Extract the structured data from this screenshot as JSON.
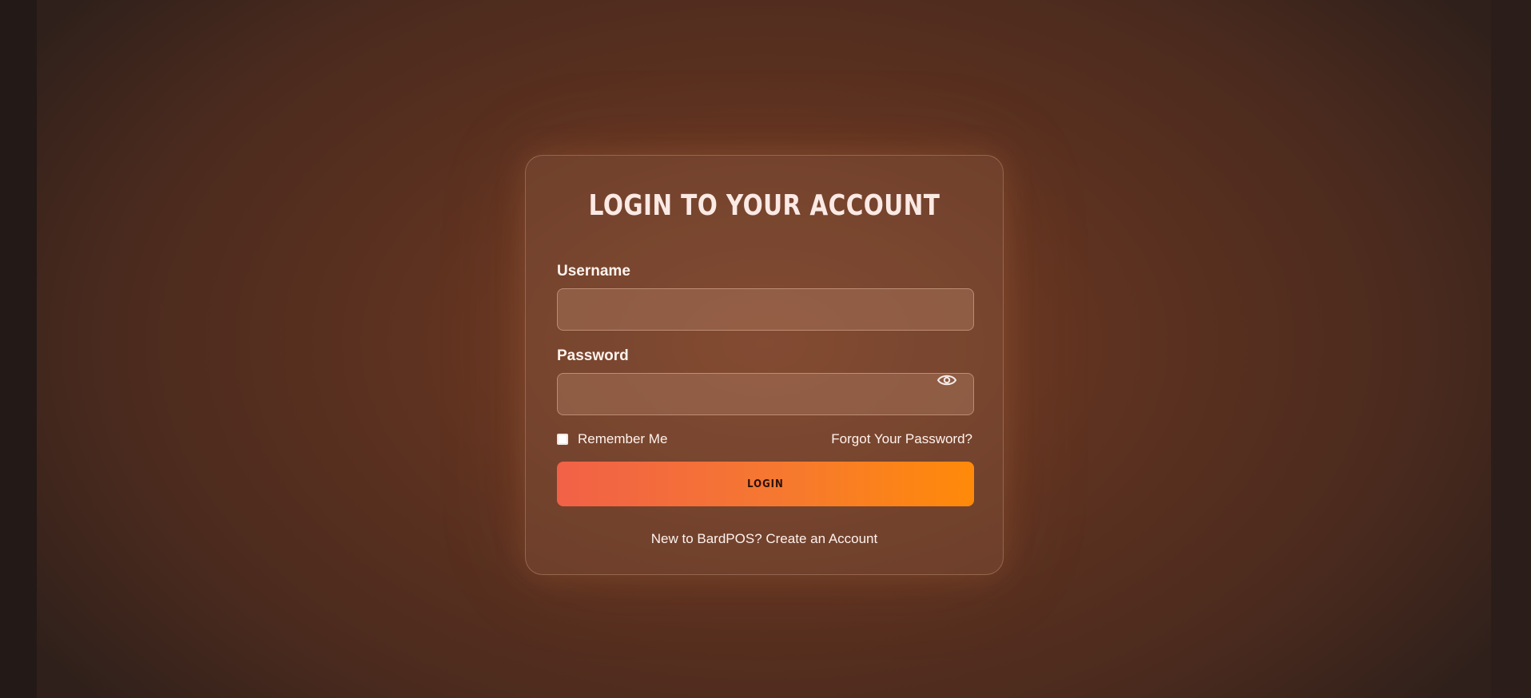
{
  "login": {
    "title": "LOGIN TO YOUR ACCOUNT",
    "username_label": "Username",
    "username_value": "",
    "password_label": "Password",
    "password_value": "",
    "remember_label": "Remember Me",
    "remember_checked": false,
    "forgot_link": "Forgot Your Password?",
    "login_button": "LOGIN",
    "signup_link": "New to BardPOS? Create an Account"
  },
  "icons": {
    "password_toggle": "eye-icon"
  },
  "colors": {
    "button_gradient_start": "#f16147",
    "button_gradient_end": "#ff8a09",
    "text": "#fff3ee"
  }
}
